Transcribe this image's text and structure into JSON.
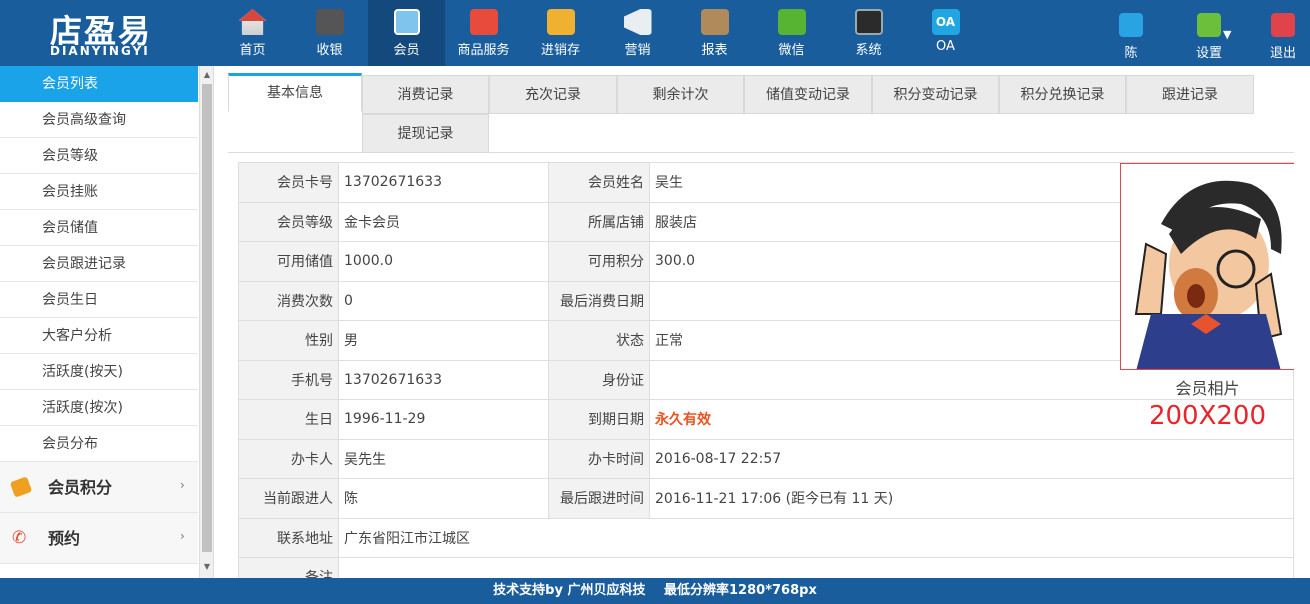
{
  "logo": {
    "cn": "店盈易",
    "en": "DIANYINGYI"
  },
  "nav": [
    {
      "label": "首页",
      "icon": "home-icon"
    },
    {
      "label": "收银",
      "icon": "cash-register-icon"
    },
    {
      "label": "会员",
      "icon": "member-icon"
    },
    {
      "label": "商品服务",
      "icon": "goods-icon"
    },
    {
      "label": "进销存",
      "icon": "inventory-icon"
    },
    {
      "label": "营销",
      "icon": "megaphone-icon"
    },
    {
      "label": "报表",
      "icon": "report-icon"
    },
    {
      "label": "微信",
      "icon": "wechat-icon"
    },
    {
      "label": "系统",
      "icon": "monitor-icon"
    },
    {
      "label": "OA",
      "icon": "oa-icon"
    }
  ],
  "nav_active": "会员",
  "oa_badge": "OA",
  "user": {
    "label": "陈",
    "icon": "user-icon"
  },
  "settings": {
    "label": "设置",
    "icon": "gear-icon"
  },
  "logout": {
    "label": "退出",
    "icon": "logout-icon"
  },
  "sidebar": {
    "items": [
      {
        "label": "会员列表",
        "active": true
      },
      {
        "label": "会员高级查询"
      },
      {
        "label": "会员等级"
      },
      {
        "label": "会员挂账"
      },
      {
        "label": "会员储值"
      },
      {
        "label": "会员跟进记录"
      },
      {
        "label": "会员生日"
      },
      {
        "label": "大客户分析"
      },
      {
        "label": "活跃度(按天)"
      },
      {
        "label": "活跃度(按次)"
      },
      {
        "label": "会员分布"
      }
    ],
    "groups": [
      {
        "label": "会员积分",
        "icon": "tag-icon"
      },
      {
        "label": "预约",
        "icon": "phone-icon"
      }
    ]
  },
  "tabs": [
    "基本信息",
    "消费记录",
    "充次记录",
    "剩余计次",
    "储值变动记录",
    "积分变动记录",
    "积分兑换记录",
    "跟进记录",
    "提现记录"
  ],
  "info": {
    "card_no_label": "会员卡号",
    "card_no": "13702671633",
    "name_label": "会员姓名",
    "name": "吴生",
    "level_label": "会员等级",
    "level": "金卡会员",
    "store_label": "所属店铺",
    "store": "服装店",
    "balance_label": "可用储值",
    "balance": "1000.0",
    "points_label": "可用积分",
    "points": "300.0",
    "visits_label": "消费次数",
    "visits": "0",
    "last_visit_label": "最后消费日期",
    "last_visit": "",
    "gender_label": "性别",
    "gender": "男",
    "status_label": "状态",
    "status": "正常",
    "phone_label": "手机号",
    "phone": "13702671633",
    "id_label": "身份证",
    "id_no": "",
    "birthday_label": "生日",
    "birthday": "1996-11-29",
    "expire_label": "到期日期",
    "expire": "永久有效",
    "issuer_label": "办卡人",
    "issuer": "吴先生",
    "issue_time_label": "办卡时间",
    "issue_time": "2016-08-17 22:57",
    "follower_label": "当前跟进人",
    "follower": "陈",
    "last_follow_label": "最后跟进时间",
    "last_follow": "2016-11-21 17:06 (距今已有 11 天)",
    "address_label": "联系地址",
    "address": "广东省阳江市江城区",
    "remark_label": "备注",
    "remark": ""
  },
  "photo": {
    "caption": "会员相片",
    "size": "200X200"
  },
  "footer": {
    "support": "技术支持by 广州贝应科技",
    "resolution": "最低分辨率1280*768px"
  }
}
